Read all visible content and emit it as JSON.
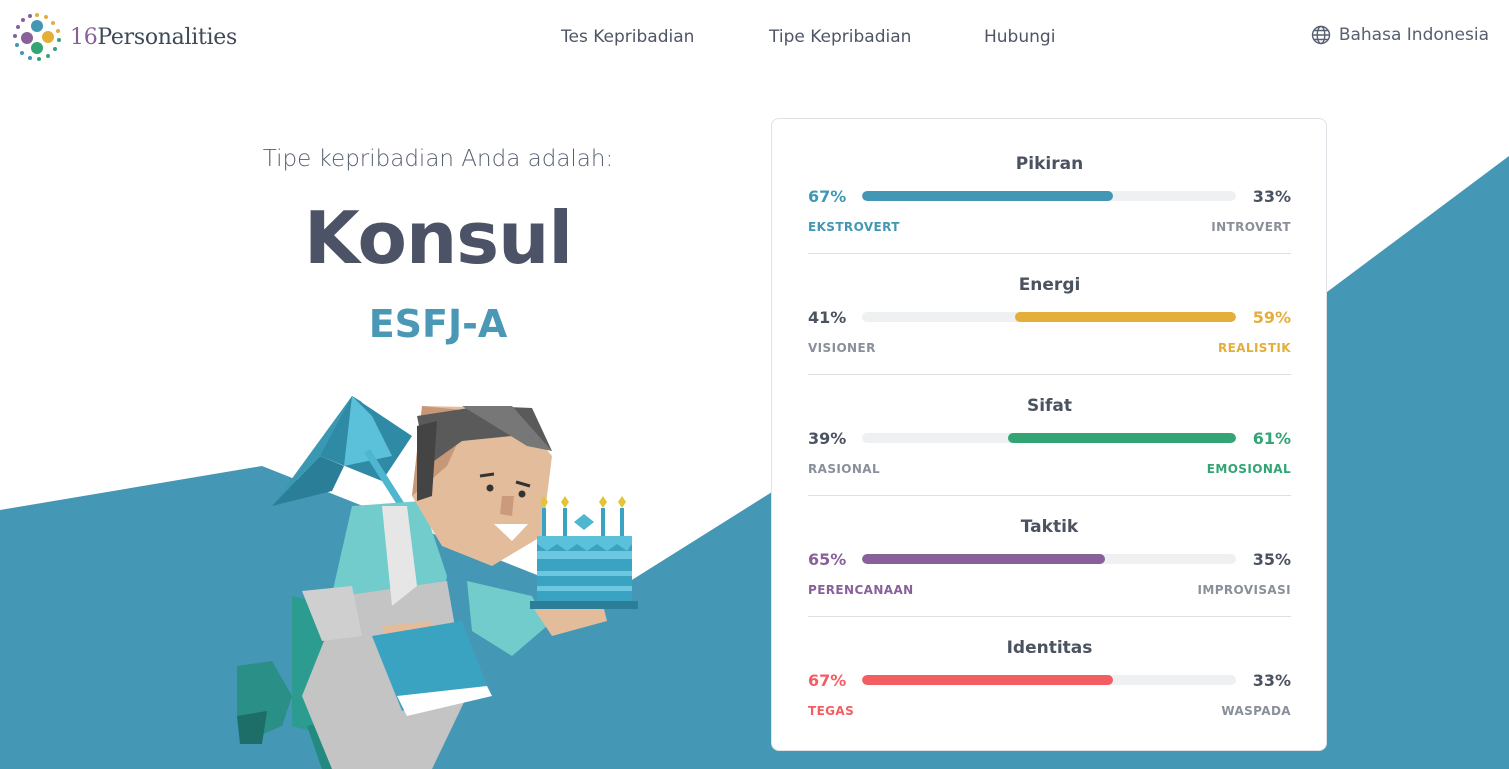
{
  "brand": {
    "logo_number": "16",
    "logo_word": "Personalities"
  },
  "nav": {
    "items": [
      {
        "label": "Tes Kepribadian"
      },
      {
        "label": "Tipe Kepribadian"
      },
      {
        "label": "Hubungi"
      }
    ],
    "language": {
      "label": "Bahasa Indonesia",
      "icon": "globe-icon"
    }
  },
  "hero": {
    "intro": "Tipe kepribadian Anda adalah:",
    "type_name": "Konsul",
    "type_code": "ESFJ-A"
  },
  "colors": {
    "teal_background": "#4497b5",
    "text_dark": "#4d5366",
    "code_blue": "#4a98b5"
  },
  "traits": [
    {
      "title": "Pikiran",
      "left_pct": "67%",
      "right_pct": "33%",
      "left_label": "EKSTROVERT",
      "right_label": "INTROVERT",
      "dominant": "left",
      "fill_fraction": 0.67,
      "color": "#4298b4"
    },
    {
      "title": "Energi",
      "left_pct": "41%",
      "right_pct": "59%",
      "left_label": "VISIONER",
      "right_label": "REALISTIK",
      "dominant": "right",
      "fill_fraction": 0.59,
      "color": "#e4ae3a"
    },
    {
      "title": "Sifat",
      "left_pct": "39%",
      "right_pct": "61%",
      "left_label": "RASIONAL",
      "right_label": "EMOSIONAL",
      "dominant": "right",
      "fill_fraction": 0.61,
      "color": "#33a474"
    },
    {
      "title": "Taktik",
      "left_pct": "65%",
      "right_pct": "35%",
      "left_label": "PERENCANAAN",
      "right_label": "IMPROVISASI",
      "dominant": "left",
      "fill_fraction": 0.65,
      "color": "#88619a"
    },
    {
      "title": "Identitas",
      "left_pct": "67%",
      "right_pct": "33%",
      "left_label": "TEGAS",
      "right_label": "WASPADA",
      "dominant": "left",
      "fill_fraction": 0.67,
      "color": "#f25e62"
    }
  ]
}
